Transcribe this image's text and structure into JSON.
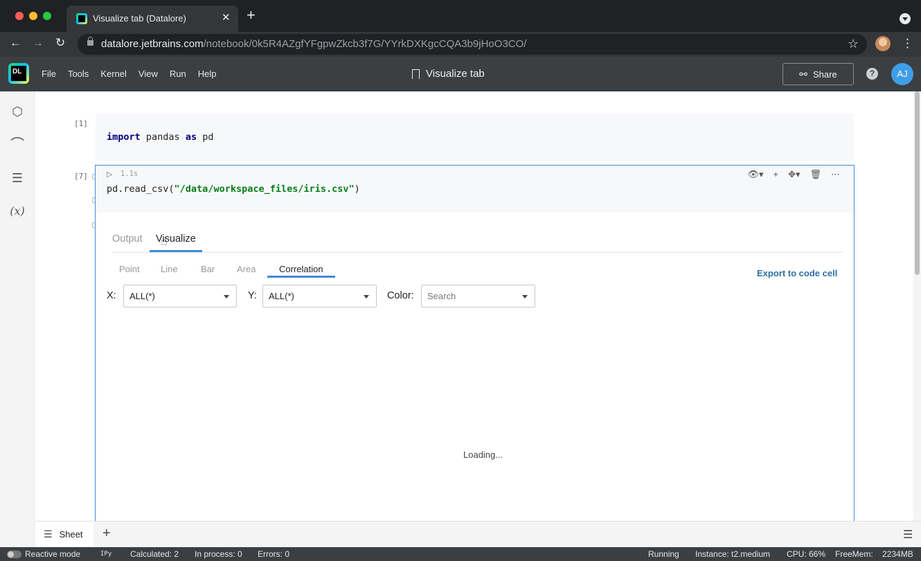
{
  "browser": {
    "tab_title": "Visualize tab (Datalore)",
    "url_host": "datalore.jetbrains.com",
    "url_path": "/notebook/0k5R4AZgfYFgpwZkcb3f7G/YYrkDXKgcCQA3b9jHoO3CO/",
    "icons": [
      "back-arrow-icon",
      "forward-arrow-icon",
      "reload-icon",
      "lock-icon",
      "star-icon",
      "more-vert-icon"
    ]
  },
  "header": {
    "logo_text": "DL",
    "menu": [
      "File",
      "Tools",
      "Kernel",
      "View",
      "Run",
      "Help"
    ],
    "notebook_title": "Visualize tab",
    "share_label": "Share",
    "help_label": "?",
    "user_initials": "AJ"
  },
  "sidebar": {
    "icons": [
      "files-cube-icon",
      "paperclip-icon",
      "outline-list-icon",
      "variables-icon"
    ],
    "vars_label": "(x)"
  },
  "cells": [
    {
      "exec_count": "[1]",
      "code": {
        "kw1": "import",
        "mid": " pandas ",
        "kw2": "as",
        "tail": " pd"
      }
    },
    {
      "exec_count": "[7]",
      "exec_time": "1.1s",
      "code": {
        "pre": "pd.read_csv(",
        "str": "\"/data/workspace_files/iris.csv\"",
        "post": ")"
      }
    }
  ],
  "output": {
    "tabs": [
      "Output",
      "Visualize"
    ],
    "active_tab": "Visualize",
    "viz_types": [
      "Point",
      "Line",
      "Bar",
      "Area",
      "Correlation"
    ],
    "active_viz": "Correlation",
    "export_label": "Export to code cell",
    "filters": {
      "x_label": "X:",
      "x_value": "ALL(*)",
      "y_label": "Y:",
      "y_value": "ALL(*)",
      "color_label": "Color:",
      "color_placeholder": "Search"
    },
    "loading": "Loading..."
  },
  "sheets": {
    "tab_label": "Sheet",
    "add_label": "+"
  },
  "status": {
    "reactive_mode": "Reactive mode",
    "kernel": "IPy",
    "calculated": "Calculated: 2",
    "in_process": "In process: 0",
    "errors": "Errors: 0",
    "state": "Running",
    "instance": "Instance: t2.medium",
    "cpu": "CPU:  66%",
    "freemem": "FreeMem:",
    "freemem_value": "2234MB"
  },
  "colors": {
    "accent": "#3f8bd6",
    "header_bg": "#3c3f41",
    "export_link": "#2f6ea5"
  }
}
